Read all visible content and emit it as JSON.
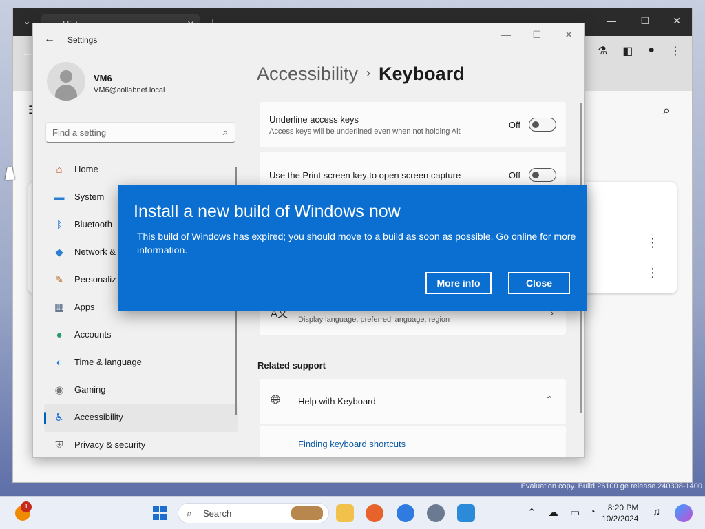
{
  "browser": {
    "tab_title": "History",
    "tab_close": "✕",
    "minimize": "—",
    "maximize": "☐",
    "close": "✕"
  },
  "settings": {
    "app_title": "Settings",
    "user": {
      "name": "VM6",
      "email": "VM6@collabnet.local"
    },
    "search_placeholder": "Find a setting",
    "nav": [
      {
        "label": "Home",
        "icon": "home-icon"
      },
      {
        "label": "System",
        "icon": "system-icon"
      },
      {
        "label": "Bluetooth",
        "icon": "bluetooth-icon"
      },
      {
        "label": "Network &",
        "icon": "network-icon"
      },
      {
        "label": "Personaliz",
        "icon": "personalization-icon"
      },
      {
        "label": "Apps",
        "icon": "apps-icon"
      },
      {
        "label": "Accounts",
        "icon": "accounts-icon"
      },
      {
        "label": "Time & language",
        "icon": "time-language-icon"
      },
      {
        "label": "Gaming",
        "icon": "gaming-icon"
      },
      {
        "label": "Accessibility",
        "icon": "accessibility-icon",
        "active": true
      },
      {
        "label": "Privacy & security",
        "icon": "privacy-icon"
      }
    ],
    "breadcrumb": {
      "parent": "Accessibility",
      "separator": "›",
      "current": "Keyboard"
    },
    "cards": {
      "underline": {
        "title": "Underline access keys",
        "subtitle": "Access keys will be underlined even when not holding Alt",
        "state": "Off"
      },
      "printscreen": {
        "title": "Use the Print screen key to open screen capture",
        "state": "Off"
      },
      "language": {
        "subtitle": "Display language, preferred language, region"
      }
    },
    "related_support": "Related support",
    "help": {
      "title": "Help with Keyboard",
      "link": "Finding keyboard shortcuts"
    }
  },
  "dialog": {
    "title": "Install a new build of Windows now",
    "body": "This build of Windows has expired; you should move to a build as soon as possible. Go online for more information.",
    "more_info": "More info",
    "close": "Close"
  },
  "watermark": "Evaluation copy. Build 26100 ge release.240308-1400",
  "taskbar": {
    "search": "Search",
    "badge": "1",
    "time": "8:20 PM",
    "date": "10/2/2024"
  }
}
